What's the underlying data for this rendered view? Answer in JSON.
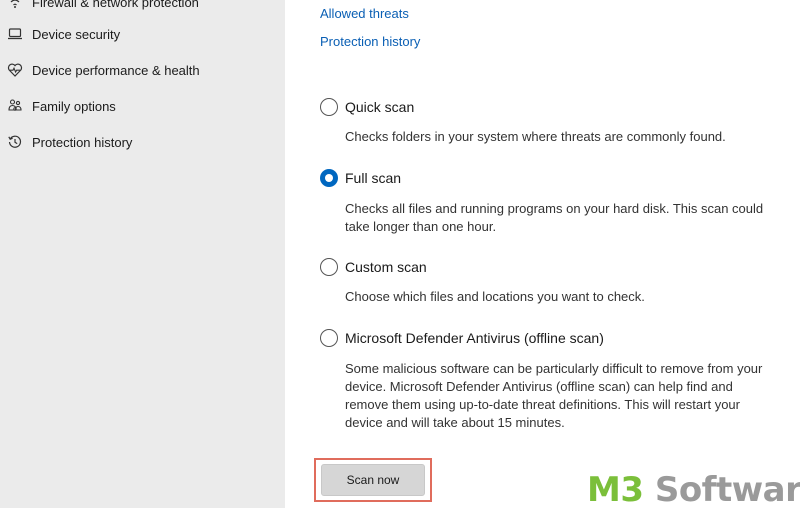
{
  "sidebar": {
    "items": [
      {
        "label": "Firewall & network protection",
        "icon": "wifi-antenna-icon"
      },
      {
        "label": "Device security",
        "icon": "laptop-icon"
      },
      {
        "label": "Device performance & health",
        "icon": "heart-pulse-icon"
      },
      {
        "label": "Family options",
        "icon": "family-icon"
      },
      {
        "label": "Protection history",
        "icon": "history-icon"
      }
    ]
  },
  "main": {
    "links": {
      "allowed_threats": "Allowed threats",
      "protection_history": "Protection history"
    },
    "scan_options": [
      {
        "label": "Quick scan",
        "description": "Checks folders in your system where threats are commonly found.",
        "selected": false
      },
      {
        "label": "Full scan",
        "description": "Checks all files and running programs on your hard disk. This scan could take longer than one hour.",
        "selected": true
      },
      {
        "label": "Custom scan",
        "description": "Choose which files and locations you want to check.",
        "selected": false
      },
      {
        "label": "Microsoft Defender Antivirus (offline scan)",
        "description": "Some malicious software can be particularly difficult to remove from your device. Microsoft Defender Antivirus (offline scan) can help find and remove them using up-to-date threat definitions. This will restart your device and will take about 15 minutes.",
        "selected": false
      }
    ],
    "scan_button": "Scan now"
  },
  "watermark": {
    "part1": "M3",
    "part2": " Software"
  },
  "colors": {
    "accent": "#0067c0",
    "link": "#0a5fb4",
    "highlight_box": "#e06c5c",
    "sidebar_bg": "#ebebeb"
  }
}
